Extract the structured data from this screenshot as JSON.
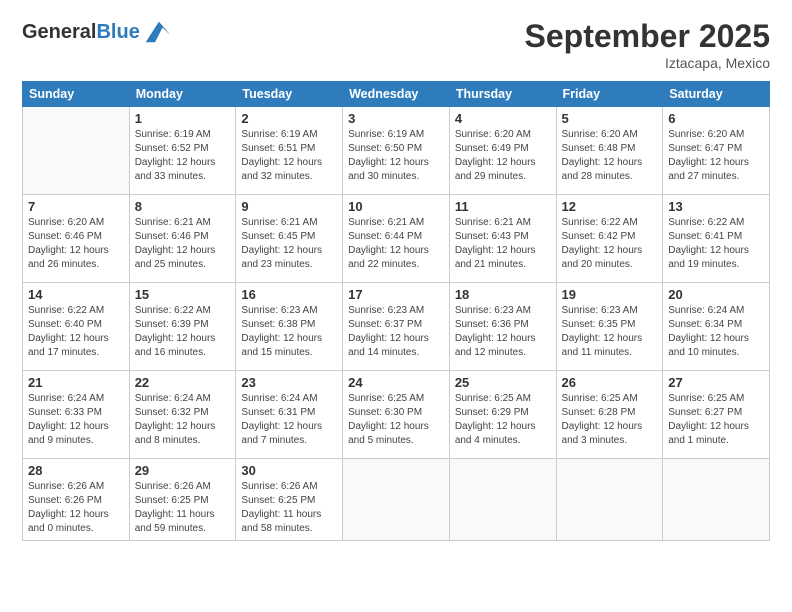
{
  "header": {
    "logo_line1": "General",
    "logo_line2": "Blue",
    "month": "September 2025",
    "location": "Iztacapa, Mexico"
  },
  "days_of_week": [
    "Sunday",
    "Monday",
    "Tuesday",
    "Wednesday",
    "Thursday",
    "Friday",
    "Saturday"
  ],
  "weeks": [
    [
      {
        "day": "",
        "info": ""
      },
      {
        "day": "1",
        "info": "Sunrise: 6:19 AM\nSunset: 6:52 PM\nDaylight: 12 hours\nand 33 minutes."
      },
      {
        "day": "2",
        "info": "Sunrise: 6:19 AM\nSunset: 6:51 PM\nDaylight: 12 hours\nand 32 minutes."
      },
      {
        "day": "3",
        "info": "Sunrise: 6:19 AM\nSunset: 6:50 PM\nDaylight: 12 hours\nand 30 minutes."
      },
      {
        "day": "4",
        "info": "Sunrise: 6:20 AM\nSunset: 6:49 PM\nDaylight: 12 hours\nand 29 minutes."
      },
      {
        "day": "5",
        "info": "Sunrise: 6:20 AM\nSunset: 6:48 PM\nDaylight: 12 hours\nand 28 minutes."
      },
      {
        "day": "6",
        "info": "Sunrise: 6:20 AM\nSunset: 6:47 PM\nDaylight: 12 hours\nand 27 minutes."
      }
    ],
    [
      {
        "day": "7",
        "info": "Sunrise: 6:20 AM\nSunset: 6:46 PM\nDaylight: 12 hours\nand 26 minutes."
      },
      {
        "day": "8",
        "info": "Sunrise: 6:21 AM\nSunset: 6:46 PM\nDaylight: 12 hours\nand 25 minutes."
      },
      {
        "day": "9",
        "info": "Sunrise: 6:21 AM\nSunset: 6:45 PM\nDaylight: 12 hours\nand 23 minutes."
      },
      {
        "day": "10",
        "info": "Sunrise: 6:21 AM\nSunset: 6:44 PM\nDaylight: 12 hours\nand 22 minutes."
      },
      {
        "day": "11",
        "info": "Sunrise: 6:21 AM\nSunset: 6:43 PM\nDaylight: 12 hours\nand 21 minutes."
      },
      {
        "day": "12",
        "info": "Sunrise: 6:22 AM\nSunset: 6:42 PM\nDaylight: 12 hours\nand 20 minutes."
      },
      {
        "day": "13",
        "info": "Sunrise: 6:22 AM\nSunset: 6:41 PM\nDaylight: 12 hours\nand 19 minutes."
      }
    ],
    [
      {
        "day": "14",
        "info": "Sunrise: 6:22 AM\nSunset: 6:40 PM\nDaylight: 12 hours\nand 17 minutes."
      },
      {
        "day": "15",
        "info": "Sunrise: 6:22 AM\nSunset: 6:39 PM\nDaylight: 12 hours\nand 16 minutes."
      },
      {
        "day": "16",
        "info": "Sunrise: 6:23 AM\nSunset: 6:38 PM\nDaylight: 12 hours\nand 15 minutes."
      },
      {
        "day": "17",
        "info": "Sunrise: 6:23 AM\nSunset: 6:37 PM\nDaylight: 12 hours\nand 14 minutes."
      },
      {
        "day": "18",
        "info": "Sunrise: 6:23 AM\nSunset: 6:36 PM\nDaylight: 12 hours\nand 12 minutes."
      },
      {
        "day": "19",
        "info": "Sunrise: 6:23 AM\nSunset: 6:35 PM\nDaylight: 12 hours\nand 11 minutes."
      },
      {
        "day": "20",
        "info": "Sunrise: 6:24 AM\nSunset: 6:34 PM\nDaylight: 12 hours\nand 10 minutes."
      }
    ],
    [
      {
        "day": "21",
        "info": "Sunrise: 6:24 AM\nSunset: 6:33 PM\nDaylight: 12 hours\nand 9 minutes."
      },
      {
        "day": "22",
        "info": "Sunrise: 6:24 AM\nSunset: 6:32 PM\nDaylight: 12 hours\nand 8 minutes."
      },
      {
        "day": "23",
        "info": "Sunrise: 6:24 AM\nSunset: 6:31 PM\nDaylight: 12 hours\nand 7 minutes."
      },
      {
        "day": "24",
        "info": "Sunrise: 6:25 AM\nSunset: 6:30 PM\nDaylight: 12 hours\nand 5 minutes."
      },
      {
        "day": "25",
        "info": "Sunrise: 6:25 AM\nSunset: 6:29 PM\nDaylight: 12 hours\nand 4 minutes."
      },
      {
        "day": "26",
        "info": "Sunrise: 6:25 AM\nSunset: 6:28 PM\nDaylight: 12 hours\nand 3 minutes."
      },
      {
        "day": "27",
        "info": "Sunrise: 6:25 AM\nSunset: 6:27 PM\nDaylight: 12 hours\nand 1 minute."
      }
    ],
    [
      {
        "day": "28",
        "info": "Sunrise: 6:26 AM\nSunset: 6:26 PM\nDaylight: 12 hours\nand 0 minutes."
      },
      {
        "day": "29",
        "info": "Sunrise: 6:26 AM\nSunset: 6:25 PM\nDaylight: 11 hours\nand 59 minutes."
      },
      {
        "day": "30",
        "info": "Sunrise: 6:26 AM\nSunset: 6:25 PM\nDaylight: 11 hours\nand 58 minutes."
      },
      {
        "day": "",
        "info": ""
      },
      {
        "day": "",
        "info": ""
      },
      {
        "day": "",
        "info": ""
      },
      {
        "day": "",
        "info": ""
      }
    ]
  ]
}
